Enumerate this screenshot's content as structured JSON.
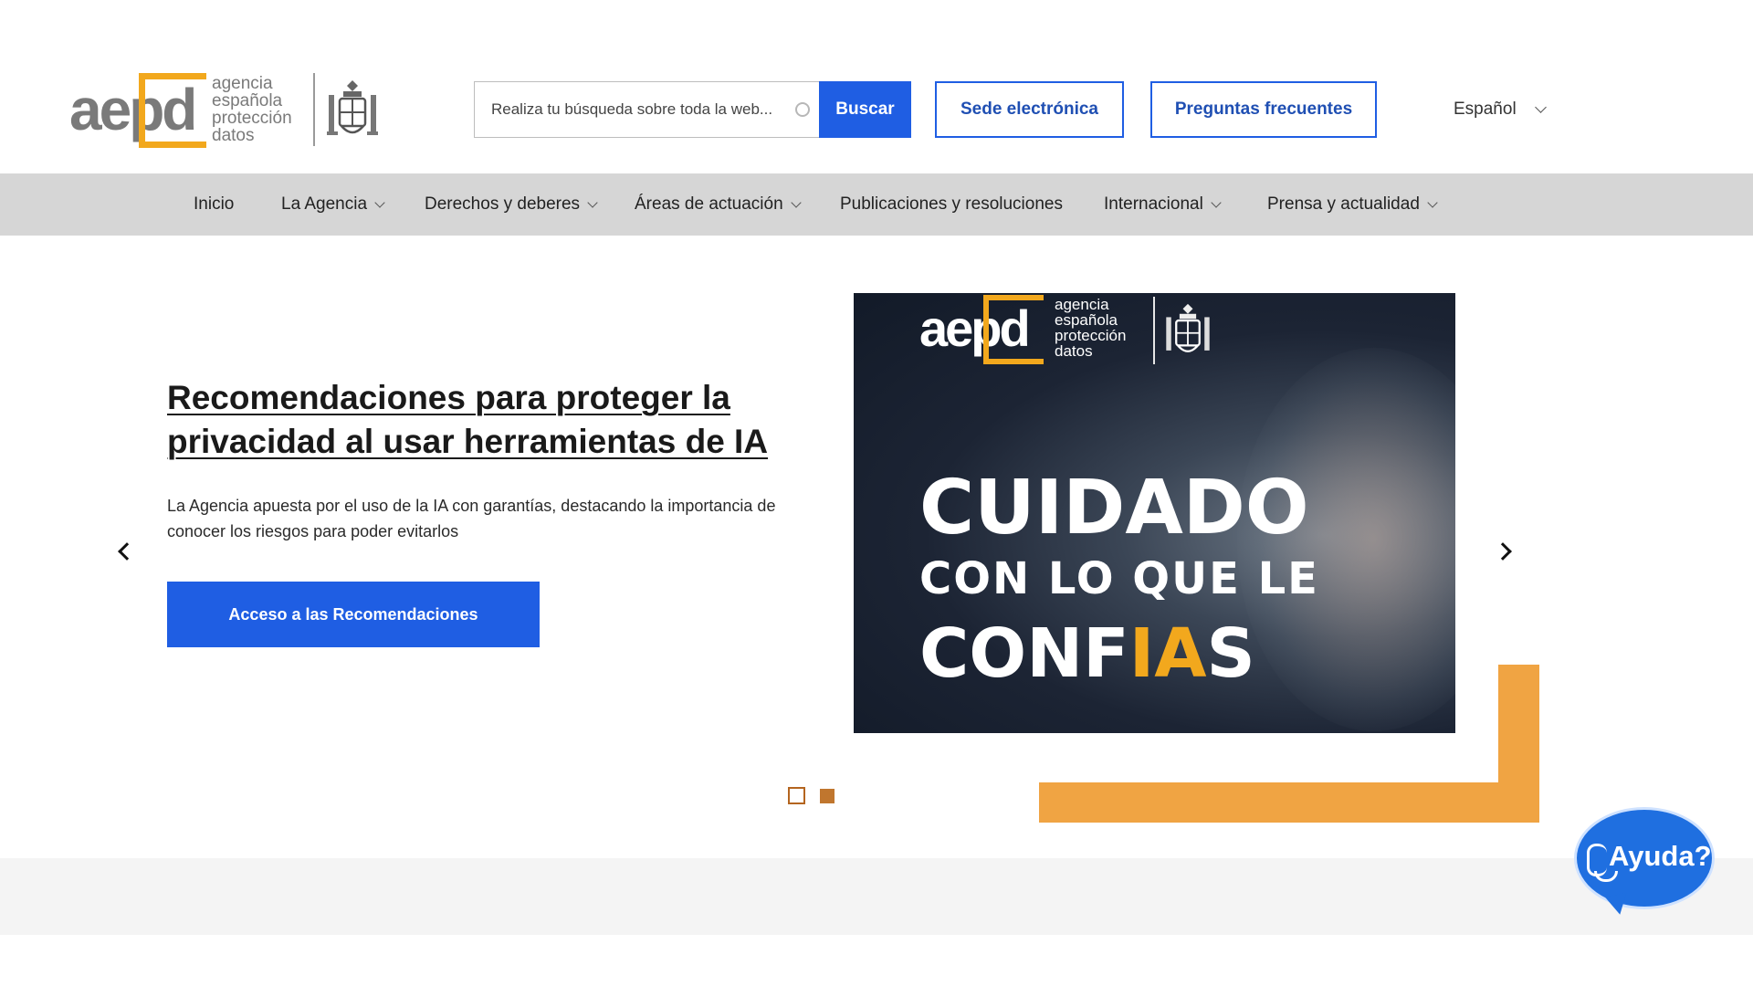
{
  "header": {
    "logo": {
      "word": "aepd",
      "lines": [
        "agencia",
        "española",
        "protección",
        "datos"
      ]
    },
    "search": {
      "placeholder": "Realiza tu búsqueda sobre toda la web..."
    },
    "search_button": "Buscar",
    "sede_button": "Sede electrónica",
    "faq_button": "Preguntas frecuentes",
    "language": "Español"
  },
  "nav": {
    "items": [
      {
        "label": "Inicio",
        "has_dropdown": false
      },
      {
        "label": "La Agencia",
        "has_dropdown": true
      },
      {
        "label": "Derechos y deberes",
        "has_dropdown": true
      },
      {
        "label": "Áreas de actuación",
        "has_dropdown": true
      },
      {
        "label": "Publicaciones y resoluciones",
        "has_dropdown": false
      },
      {
        "label": "Internacional",
        "has_dropdown": true
      },
      {
        "label": "Prensa y actualidad",
        "has_dropdown": true
      }
    ]
  },
  "hero": {
    "title": "Recomendaciones para proteger la privacidad al usar herramientas de IA",
    "description": "La Agencia apuesta por el uso de la IA con garantías, destacando la importancia de conocer los riesgos para poder evitarlos",
    "cta": "Acceso a las Recomendaciones",
    "banner": {
      "logo_word": "aepd",
      "logo_lines": [
        "agencia",
        "española",
        "protección",
        "datos"
      ],
      "line1": "CUIDADO",
      "line2": "CON LO QUE LE",
      "line3_pre": "CONF",
      "line3_highlight": "IA",
      "line3_post": "S"
    },
    "slides": {
      "count": 2,
      "active": 2
    }
  },
  "help": {
    "label": "Ayuda?"
  },
  "colors": {
    "primary": "#1f5ee3",
    "accent": "#f2a81d",
    "deco": "#f0a443",
    "nav_bg": "#d6d6d6"
  },
  "icons": {
    "search_loading": "spinner-icon",
    "prev": "chevron-left-icon",
    "next": "chevron-right-icon",
    "dropdown": "chevron-down-icon",
    "help": "microphone-icon"
  }
}
